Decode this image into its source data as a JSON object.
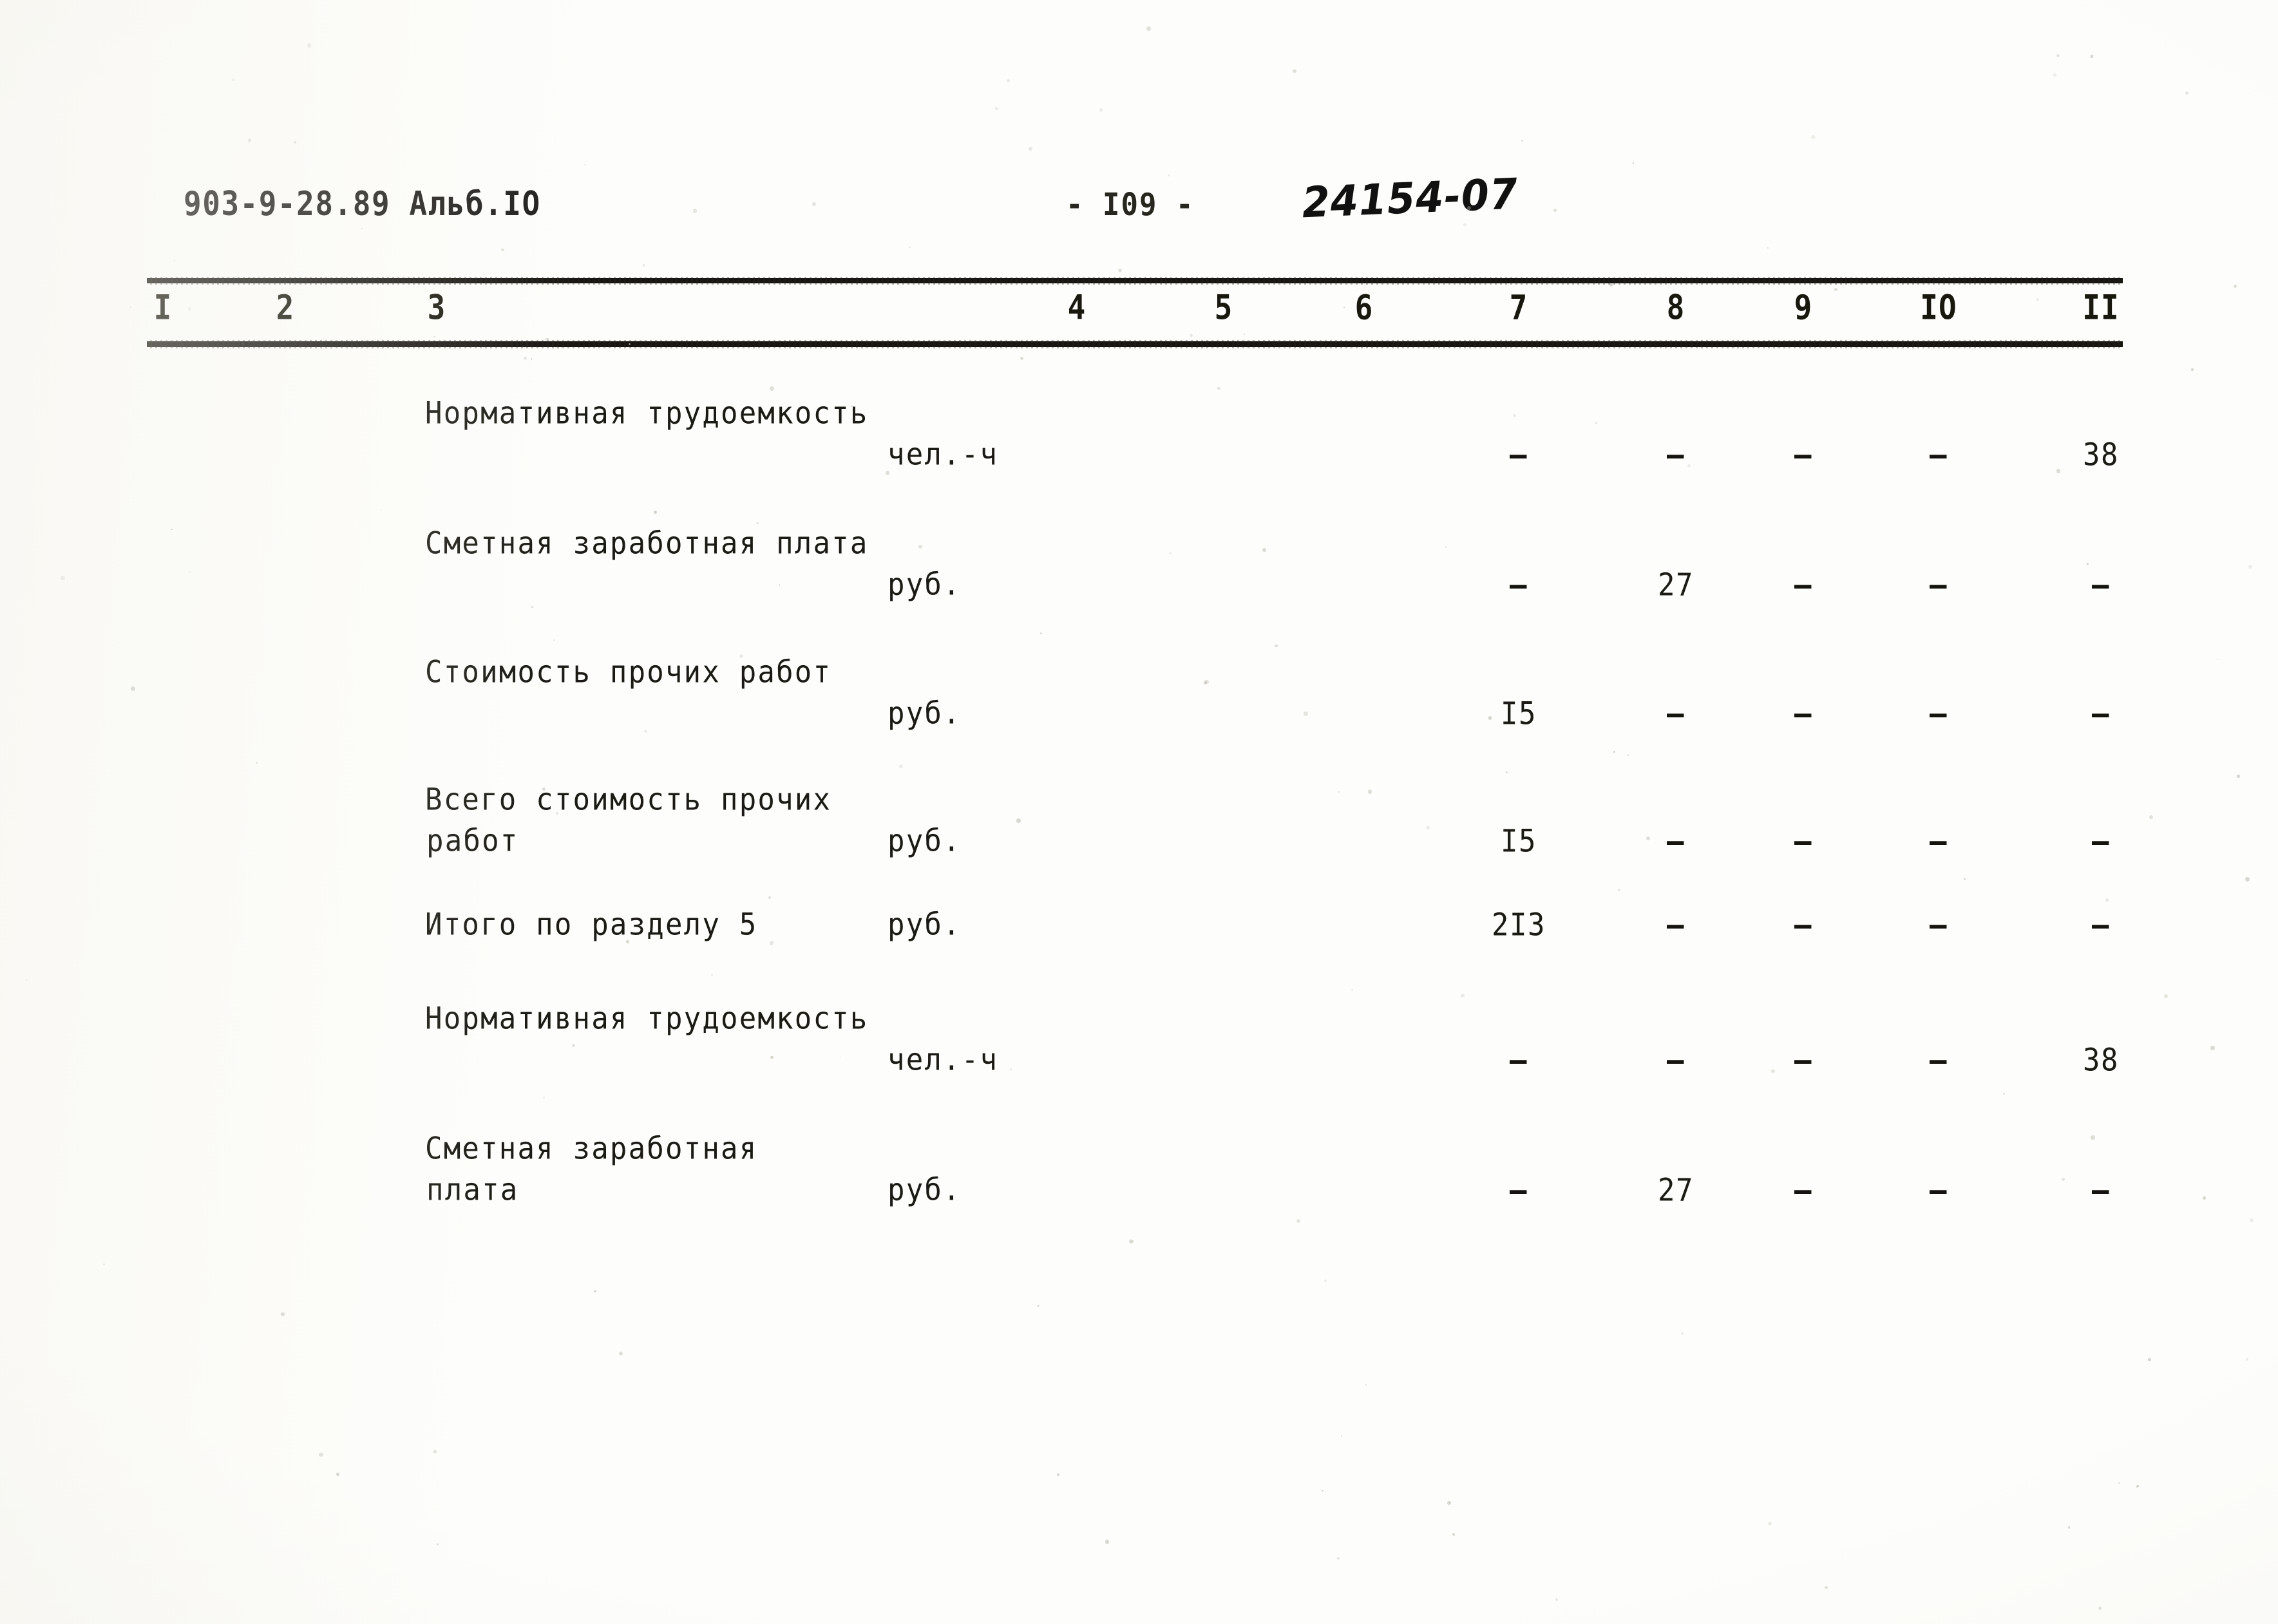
{
  "header": {
    "doc_code": "903-9-28.89  Альб.IO",
    "page_number": "- I09 -",
    "hand_note": "24154-07"
  },
  "table": {
    "column_numbers": [
      "I",
      "2",
      "3",
      "4",
      "5",
      "6",
      "7",
      "8",
      "9",
      "IO",
      "II"
    ],
    "rows": [
      {
        "label_line1": "Нормативная трудоемкость",
        "label_line2": "",
        "unit": "чел.-ч",
        "unit_on_line": 2,
        "values": {
          "c4": "",
          "c5": "",
          "c6": "",
          "c7": "—",
          "c8": "—",
          "c9": "—",
          "c10": "—",
          "c11": "38"
        }
      },
      {
        "label_line1": "Сметная заработная плата",
        "label_line2": "",
        "unit": "руб.",
        "unit_on_line": 2,
        "values": {
          "c4": "",
          "c5": "",
          "c6": "",
          "c7": "—",
          "c8": "27",
          "c9": "—",
          "c10": "—",
          "c11": "—"
        }
      },
      {
        "label_line1": "Стоимость прочих работ",
        "label_line2": "",
        "unit": "руб.",
        "unit_on_line": 2,
        "values": {
          "c4": "",
          "c5": "",
          "c6": "",
          "c7": "I5",
          "c8": "—",
          "c9": "—",
          "c10": "—",
          "c11": "—"
        }
      },
      {
        "label_line1": "Всего стоимость прочих",
        "label_line2": "работ",
        "unit": "руб.",
        "unit_on_line": 2,
        "values": {
          "c4": "",
          "c5": "",
          "c6": "",
          "c7": "I5",
          "c8": "—",
          "c9": "—",
          "c10": "—",
          "c11": "—"
        }
      },
      {
        "label_line1": "Итого по разделу 5",
        "label_line2": "",
        "unit": "руб.",
        "unit_on_line": 1,
        "values": {
          "c4": "",
          "c5": "",
          "c6": "",
          "c7": "2I3",
          "c8": "—",
          "c9": "—",
          "c10": "—",
          "c11": "—"
        }
      },
      {
        "label_line1": "Нормативная трудоемкость",
        "label_line2": "",
        "unit": "чел.-ч",
        "unit_on_line": 2,
        "values": {
          "c4": "",
          "c5": "",
          "c6": "",
          "c7": "—",
          "c8": "—",
          "c9": "—",
          "c10": "—",
          "c11": "38"
        }
      },
      {
        "label_line1": "Сметная заработная",
        "label_line2": "плата",
        "unit": "руб.",
        "unit_on_line": 2,
        "values": {
          "c4": "",
          "c5": "",
          "c6": "",
          "c7": "—",
          "c8": "27",
          "c9": "—",
          "c10": "—",
          "c11": "—"
        }
      }
    ]
  }
}
